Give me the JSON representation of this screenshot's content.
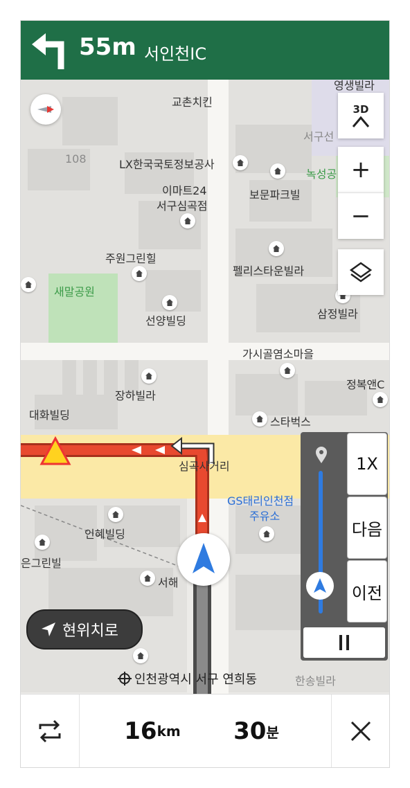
{
  "guidance": {
    "distance": "55m",
    "destination": "서인천IC",
    "turn_icon": "turn-left-arrow-icon"
  },
  "map_labels": [
    {
      "text": "교촌치킨",
      "cls": ""
    },
    {
      "text": "108",
      "cls": "muted"
    },
    {
      "text": "LX한국국토정보공사",
      "cls": ""
    },
    {
      "text": "서구선",
      "cls": "muted"
    },
    {
      "text": "녹성공",
      "cls": "green"
    },
    {
      "text": "이마트24",
      "cls": ""
    },
    {
      "text": "서구심곡점",
      "cls": ""
    },
    {
      "text": "보문파크빌",
      "cls": ""
    },
    {
      "text": "주원그린힐",
      "cls": ""
    },
    {
      "text": "펠리스타운빌라",
      "cls": ""
    },
    {
      "text": "새말공원",
      "cls": "green"
    },
    {
      "text": "삼정빌라",
      "cls": ""
    },
    {
      "text": "선양빌딩",
      "cls": ""
    },
    {
      "text": "가시골염소마을",
      "cls": ""
    },
    {
      "text": "정복앤C",
      "cls": ""
    },
    {
      "text": "장하빌라",
      "cls": ""
    },
    {
      "text": "대화빌딩",
      "cls": ""
    },
    {
      "text": "스타벅스",
      "cls": ""
    },
    {
      "text": "심곡사거리",
      "cls": ""
    },
    {
      "text": "GS태리인천점",
      "cls": "blue"
    },
    {
      "text": "주유소",
      "cls": "blue"
    },
    {
      "text": "인혜빌딩",
      "cls": ""
    },
    {
      "text": "은그린빌",
      "cls": ""
    },
    {
      "text": "서해",
      "cls": ""
    },
    {
      "text": "영생빌라",
      "cls": ""
    },
    {
      "text": "한송빌라",
      "cls": "muted"
    }
  ],
  "controls": {
    "view_3d": "3D",
    "zoom_in": "+",
    "zoom_out": "−"
  },
  "simulation": {
    "speed": "1X",
    "next": "다음",
    "prev": "이전"
  },
  "my_location_label": "현위치로",
  "address": "인천광역시 서구 연희동",
  "trip": {
    "distance_value": "16",
    "distance_unit": "km",
    "time_value": "30",
    "time_unit": "분"
  },
  "colors": {
    "header": "#1f6f47",
    "route": "#e8492f",
    "nav_arrow": "#2f7be0"
  }
}
